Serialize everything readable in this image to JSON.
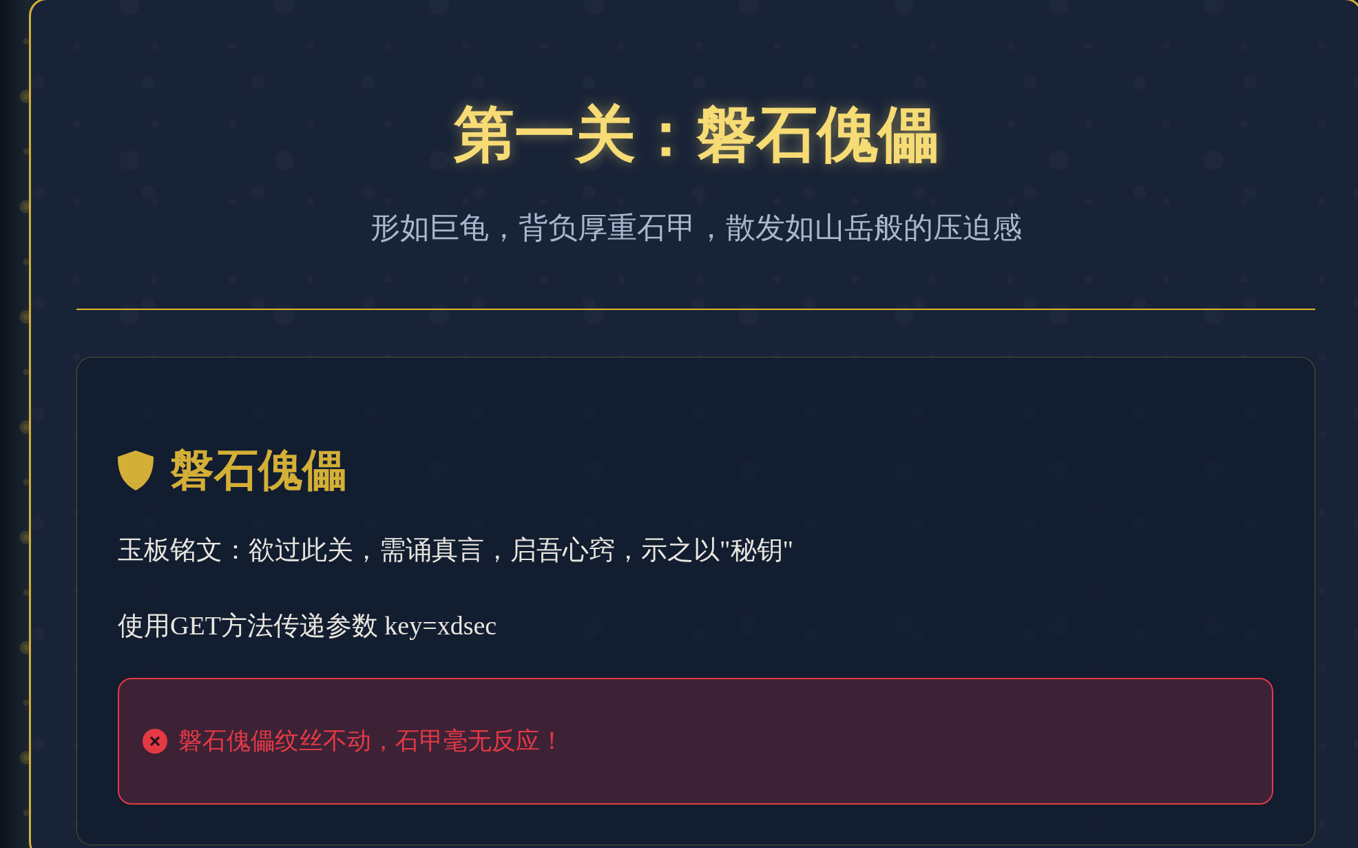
{
  "level": {
    "title": "第一关：磐石傀儡",
    "subtitle": "形如巨龟，背负厚重石甲，散发如山岳般的压迫感"
  },
  "card": {
    "heading": "磐石傀儡",
    "paragraphs": [
      "玉板铭文：欲过此关，需诵真言，启吾心窍，示之以\"秘钥\"",
      "使用GET方法传递参数 key=xdsec"
    ],
    "alert": {
      "kind": "error",
      "message": "磐石傀儡纹丝不动，石甲毫无反应！"
    }
  }
}
